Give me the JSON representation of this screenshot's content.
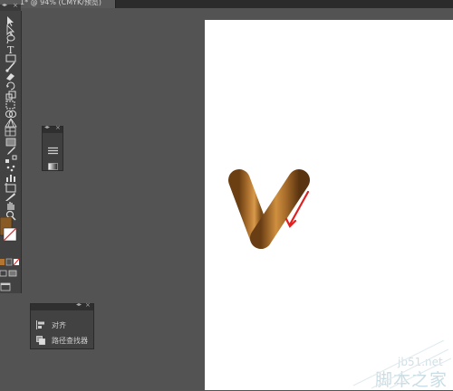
{
  "window": {
    "doc_tab_title": "1* @ 94% (CMYK/预览)"
  },
  "toolbar": {
    "collapse_arrows": "◂▸",
    "close": "×",
    "tools": [
      "selection",
      "direct-selection",
      "lasso",
      "type",
      "rectangle",
      "paintbrush",
      "eraser",
      "rotate",
      "scale",
      "free-transform",
      "shape-builder",
      "perspective-grid",
      "mesh",
      "gradient",
      "eyedropper",
      "blend",
      "symbol-sprayer",
      "column-graph",
      "artboard",
      "slice",
      "hand",
      "zoom"
    ]
  },
  "float_panel": {
    "arrows": "◂▸",
    "close": "×"
  },
  "align_panel": {
    "arrows": "◂▸",
    "close": "×",
    "items": [
      {
        "label": "对齐",
        "icon": "align-icon"
      },
      {
        "label": "路径查找器",
        "icon": "pathfinder-icon"
      }
    ]
  },
  "colors": {
    "shape_brown": "#8a5a24",
    "shape_highlight": "#d99a4a",
    "arrow_red": "#e02020"
  },
  "watermark": {
    "site": "jb51.net",
    "name": "脚本之家"
  }
}
